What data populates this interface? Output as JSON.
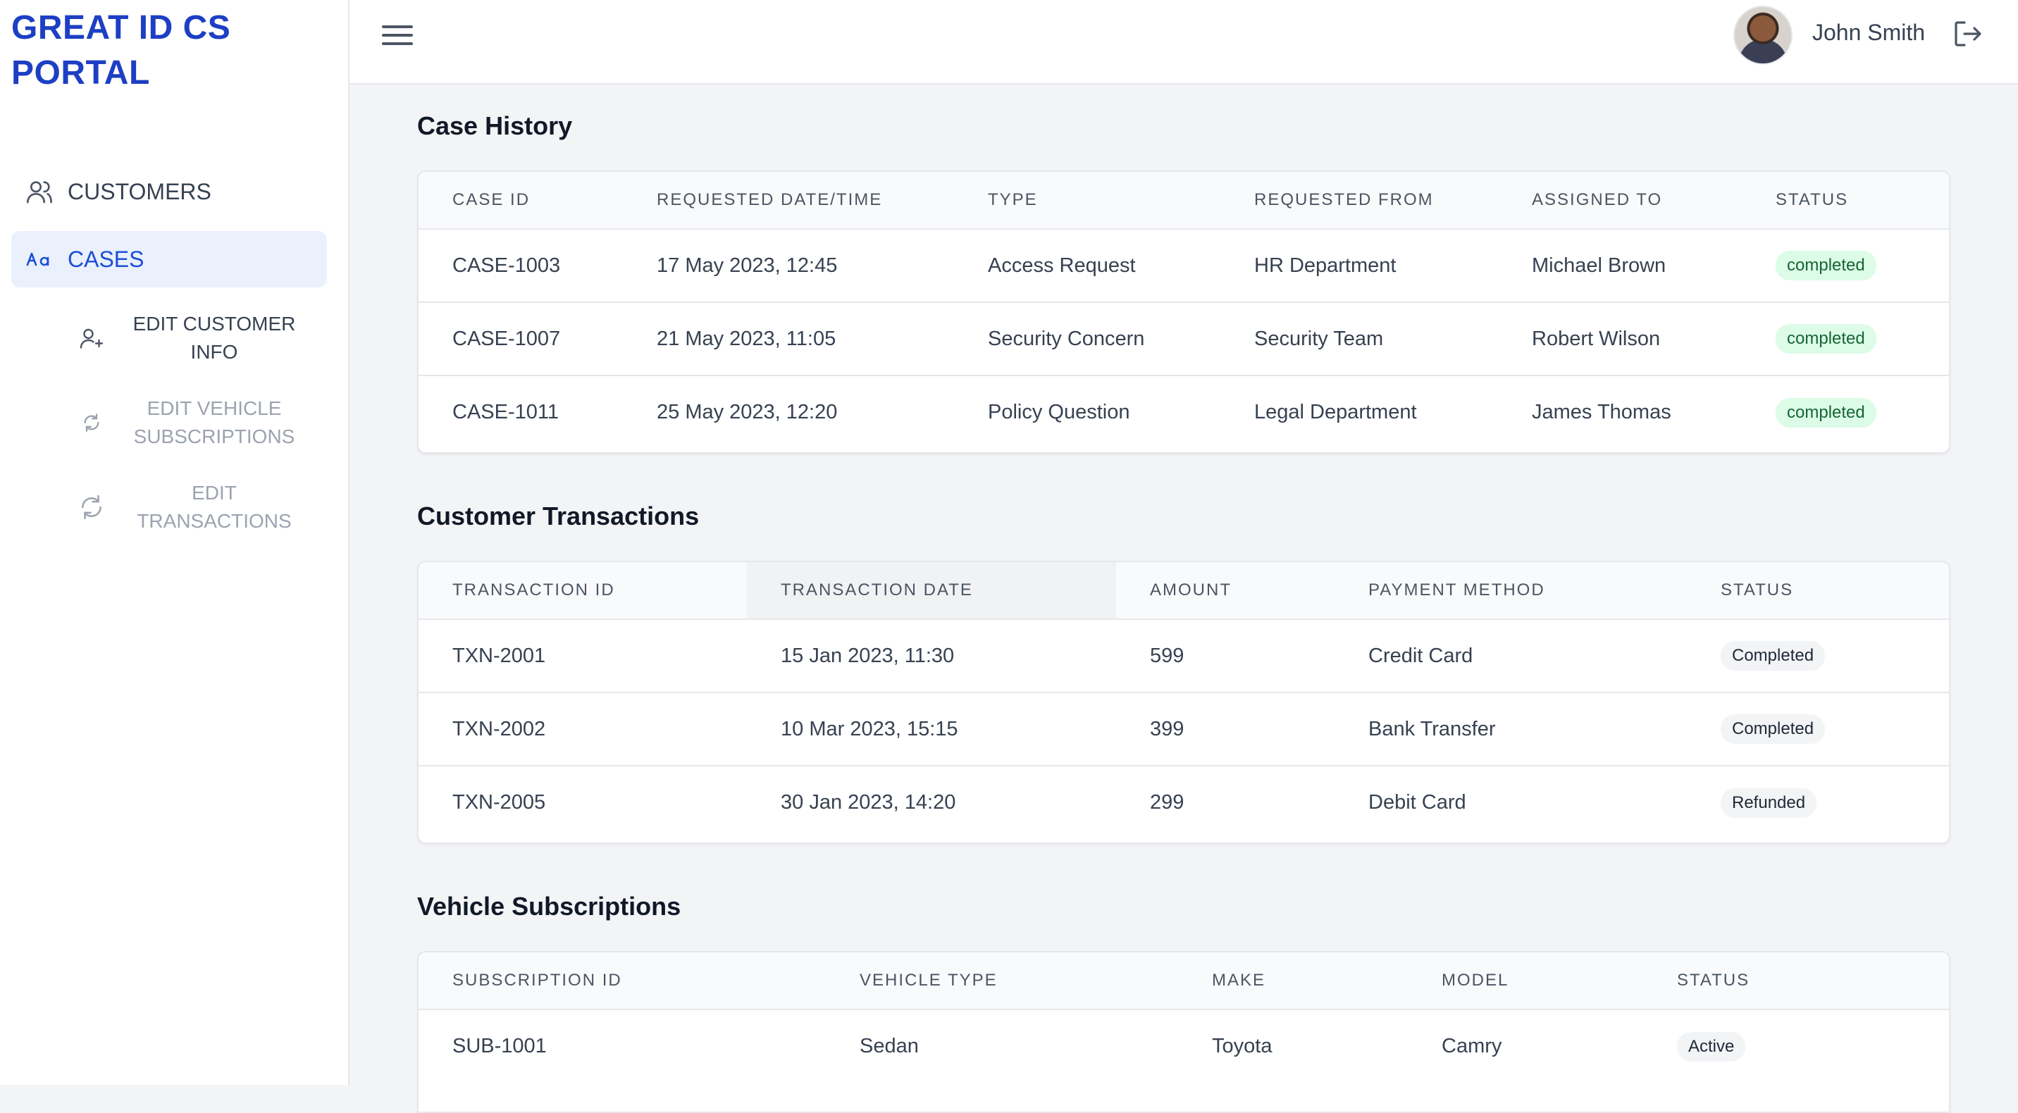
{
  "brand": {
    "line1": "GREAT ID CS",
    "line2": "PORTAL"
  },
  "sidebar": {
    "items": [
      {
        "label": "CUSTOMERS",
        "icon": "users-icon",
        "active": false
      },
      {
        "label": "CASES",
        "icon": "text-size-icon",
        "active": true
      }
    ],
    "sub_items": [
      {
        "line1": "EDIT CUSTOMER",
        "line2": "INFO",
        "icon": "user-plus-icon"
      },
      {
        "line1": "EDIT VEHICLE",
        "line2": "SUBSCRIPTIONS",
        "icon": "refresh-small-icon"
      },
      {
        "line1": "EDIT",
        "line2": "TRANSACTIONS",
        "icon": "refresh-icon"
      }
    ]
  },
  "header": {
    "user_name": "John Smith"
  },
  "case_history": {
    "title": "Case History",
    "columns": [
      "CASE ID",
      "REQUESTED DATE/TIME",
      "TYPE",
      "REQUESTED FROM",
      "ASSIGNED TO",
      "STATUS"
    ],
    "rows": [
      [
        "CASE-1003",
        "17 May 2023, 12:45",
        "Access Request",
        "HR Department",
        "Michael Brown",
        "completed"
      ],
      [
        "CASE-1007",
        "21 May 2023, 11:05",
        "Security Concern",
        "Security Team",
        "Robert Wilson",
        "completed"
      ],
      [
        "CASE-1011",
        "25 May 2023, 12:20",
        "Policy Question",
        "Legal Department",
        "James Thomas",
        "completed"
      ]
    ]
  },
  "transactions": {
    "title": "Customer Transactions",
    "columns": [
      "TRANSACTION ID",
      "TRANSACTION DATE",
      "AMOUNT",
      "PAYMENT METHOD",
      "STATUS"
    ],
    "rows": [
      [
        "TXN-2001",
        "15 Jan 2023, 11:30",
        "599",
        "Credit Card",
        "Completed"
      ],
      [
        "TXN-2002",
        "10 Mar 2023, 15:15",
        "399",
        "Bank Transfer",
        "Completed"
      ],
      [
        "TXN-2005",
        "30 Jan 2023, 14:20",
        "299",
        "Debit Card",
        "Refunded"
      ]
    ]
  },
  "subscriptions": {
    "title": "Vehicle Subscriptions",
    "columns": [
      "SUBSCRIPTION ID",
      "VEHICLE TYPE",
      "MAKE",
      "MODEL",
      "STATUS"
    ],
    "rows": [
      [
        "SUB-1001",
        "Sedan",
        "Toyota",
        "Camry",
        "Active"
      ]
    ]
  },
  "colors": {
    "brand": "#1d3fc4",
    "active_bg": "#eaf1fd",
    "status_green_bg": "#dcfce7",
    "status_green_text": "#166534"
  }
}
